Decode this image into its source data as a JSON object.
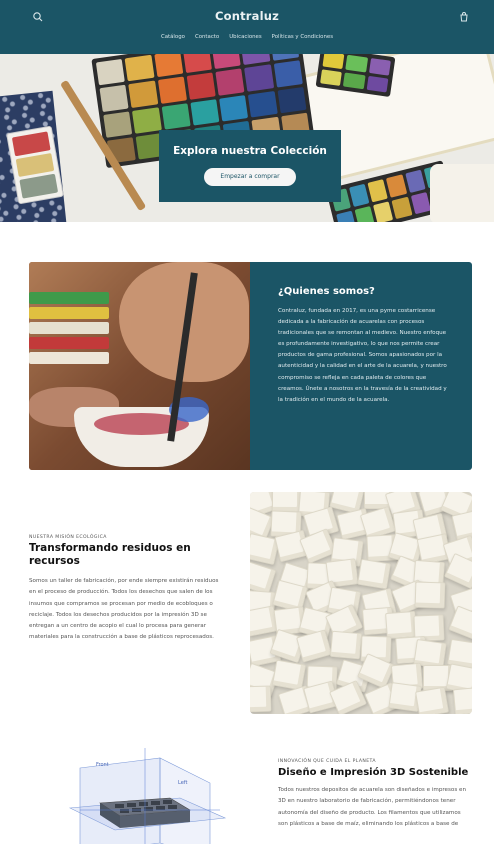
{
  "header": {
    "brand": "Contraluz",
    "nav": [
      "Catálogo",
      "Contacto",
      "Ubicaciones",
      "Políticas y Condiciones"
    ],
    "icons": [
      "search-icon",
      "cart-icon"
    ],
    "bg_color": "#1b5566"
  },
  "hero": {
    "title": "Explora nuestra Colección",
    "button": "Empezar a comprar"
  },
  "about": {
    "title": "¿Quienes somos?",
    "body": "Contraluz, fundada en 2017, es una pyme costarricense dedicada a la fabricación de acuarelas con procesos tradicionales que se remontan al medievo. Nuestro enfoque es profundamente investigativo, lo que nos permite crear productos de gama profesional. Somos apasionados por la autenticidad y la calidad en el arte de la acuarela, y nuestro compromiso se refleja en cada paleta de colores que creamos. Únete a nosotros en la travesía de la creatividad y la tradición en el mundo de la acuarela."
  },
  "eco": {
    "kicker": "NUESTRA MISIÓN ECOLÓGICA",
    "title": "Transformando residuos en recursos",
    "body": "Somos un taller de fabricación, por ende siempre existirán residuos en el proceso de producción. Todos los desechos que salen de los insumos que compramos se procesan por medio de ecobloques o reciclaje. Todos los desechos producidos por la impresión 3D se entregan a un centro de acopio el cual lo procesa para generar materiales para la construcción a base de plásticos reprocesados."
  },
  "threed": {
    "kicker": "INNOVACIÓN QUE CUIDA EL PLANETA",
    "title": "Diseño e Impresión 3D Sostenible",
    "body": "Todos nuestros depositos de acuarela son diseñados e impresos en 3D en nuestro laboratorio de fabricación, permitiéndonos tener autonomía del diseño de producto. Los filamentos que utilizamos son plásticos a base de maíz, eliminando los plásticos a base de",
    "diagram_labels": [
      "Front",
      "Left"
    ]
  }
}
